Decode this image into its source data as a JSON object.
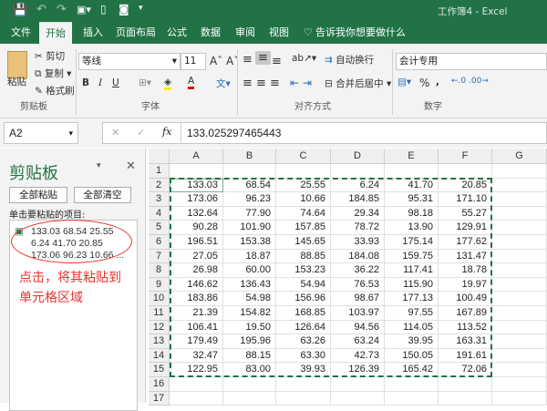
{
  "title": "工作簿4  -  Excel",
  "tabs": [
    "文件",
    "开始",
    "插入",
    "页面布局",
    "公式",
    "数据",
    "审阅",
    "视图"
  ],
  "tell_me": "告诉我你想要做什么",
  "ribbon": {
    "paste": "粘贴",
    "cut": "剪切",
    "copy": "复制",
    "format_painter": "格式刷",
    "font_name": "等线",
    "font_size": "11",
    "bold": "B",
    "italic": "I",
    "underline": "U",
    "wrap_text": "自动换行",
    "merge_center": "合并后居中",
    "number_format": "会计专用",
    "percent": "%",
    "comma": ",",
    "groups": [
      "剪贴板",
      "字体",
      "对齐方式",
      "数字"
    ]
  },
  "formula_bar": {
    "name_box": "A2",
    "fx": "fx",
    "value": "133.025297465443"
  },
  "clipboard_pane": {
    "title": "剪贴板",
    "paste_all": "全部粘贴",
    "clear_all": "全部清空",
    "instruction": "单击要粘贴的项目:",
    "item_lines": [
      "133.03 68.54 25.55",
      "6.24 41.70 20.85",
      "173.06 96.23 10.66 ..."
    ],
    "annotation_lines": [
      "点击，将其粘贴到",
      "单元格区域"
    ]
  },
  "sheet": {
    "columns": [
      "A",
      "B",
      "C",
      "D",
      "E",
      "F",
      "G"
    ],
    "rows": [
      "1",
      "2",
      "3",
      "4",
      "5",
      "6",
      "7",
      "8",
      "9",
      "10",
      "11",
      "12",
      "13",
      "14",
      "15",
      "16",
      "17"
    ],
    "data": [
      [
        "133.03",
        "68.54",
        "25.55",
        "6.24",
        "41.70",
        "20.85"
      ],
      [
        "173.06",
        "96.23",
        "10.66",
        "184.85",
        "95.31",
        "171.10"
      ],
      [
        "132.64",
        "77.90",
        "74.64",
        "29.34",
        "98.18",
        "55.27"
      ],
      [
        "90.28",
        "101.90",
        "157.85",
        "78.72",
        "13.90",
        "129.91"
      ],
      [
        "196.51",
        "153.38",
        "145.65",
        "33.93",
        "175.14",
        "177.62"
      ],
      [
        "27.05",
        "18.87",
        "88.85",
        "184.08",
        "159.75",
        "131.47"
      ],
      [
        "26.98",
        "60.00",
        "153.23",
        "36.22",
        "117.41",
        "18.78"
      ],
      [
        "146.62",
        "136.43",
        "54.94",
        "76.53",
        "115.90",
        "19.97"
      ],
      [
        "183.86",
        "54.98",
        "156.96",
        "98.67",
        "177.13",
        "100.49"
      ],
      [
        "21.39",
        "154.82",
        "168.85",
        "103.97",
        "97.55",
        "167.89"
      ],
      [
        "106.41",
        "19.50",
        "126.64",
        "94.56",
        "114.05",
        "113.52"
      ],
      [
        "179.49",
        "195.96",
        "63.26",
        "63.24",
        "39.95",
        "163.31"
      ],
      [
        "32.47",
        "88.15",
        "63.30",
        "42.73",
        "150.05",
        "191.61"
      ],
      [
        "122.95",
        "83.00",
        "39.93",
        "126.39",
        "165.42",
        "72.06"
      ]
    ]
  },
  "colors": {
    "brand": "#217346",
    "marquee": "#217346",
    "annotation": "#e8322c"
  }
}
